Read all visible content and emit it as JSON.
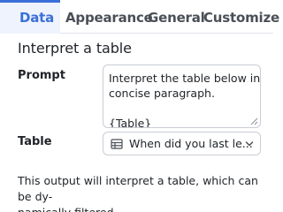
{
  "tabs": [
    {
      "label": "Data",
      "active": true
    },
    {
      "label": "Appearance",
      "active": false
    },
    {
      "label": "General",
      "active": false
    },
    {
      "label": "Customize",
      "active": false
    }
  ],
  "section_title": "Interpret a table",
  "prompt": {
    "label": "Prompt",
    "lines": [
      "Interpret the table below in a",
      "concise paragraph.",
      "",
      "{Table}"
    ]
  },
  "table": {
    "label": "Table",
    "selected_value": "When did you last le...",
    "icon": "table-grid-icon"
  },
  "footnote": {
    "line1": "This output will interpret a table, which can be dy-",
    "line2": "namically filtered."
  },
  "colors": {
    "accent": "#3b6fd8",
    "active_tab_bg": "#eef3fd",
    "border": "#c9cdd4",
    "text": "#1f2328"
  }
}
